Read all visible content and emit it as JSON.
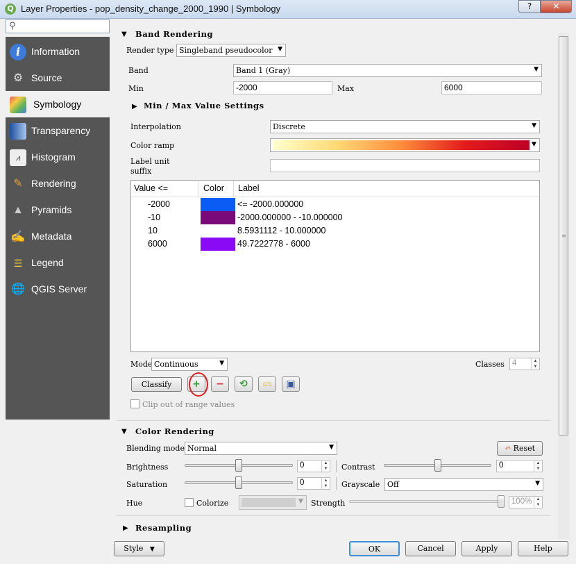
{
  "window": {
    "title": "Layer Properties - pop_density_change_2000_1990 | Symbology",
    "app_icon": "Q",
    "help_label": "?",
    "close_label": "✕"
  },
  "sidebar": {
    "search_placeholder": "",
    "items": [
      {
        "label": "Information",
        "icon": "info-icon"
      },
      {
        "label": "Source",
        "icon": "source-icon"
      },
      {
        "label": "Symbology",
        "icon": "symbology-icon"
      },
      {
        "label": "Transparency",
        "icon": "transparency-icon"
      },
      {
        "label": "Histogram",
        "icon": "histogram-icon"
      },
      {
        "label": "Rendering",
        "icon": "rendering-icon"
      },
      {
        "label": "Pyramids",
        "icon": "pyramids-icon"
      },
      {
        "label": "Metadata",
        "icon": "metadata-icon"
      },
      {
        "label": "Legend",
        "icon": "legend-icon"
      },
      {
        "label": "QGIS Server",
        "icon": "server-icon"
      }
    ],
    "active_index": 2
  },
  "band_rendering": {
    "title": "Band Rendering",
    "render_type_label": "Render type",
    "render_type_value": "Singleband pseudocolor",
    "band_label": "Band",
    "band_value": "Band 1 (Gray)",
    "min_label": "Min",
    "min_value": "-2000",
    "max_label": "Max",
    "max_value": "6000",
    "minmax_settings_label": "Min / Max Value Settings",
    "interpolation_label": "Interpolation",
    "interpolation_value": "Discrete",
    "color_ramp_label": "Color ramp",
    "color_ramp_colors": [
      "#ffffcc",
      "#fed976",
      "#fd8d3c",
      "#e31a1c",
      "#bd0026"
    ],
    "label_unit_label_1": "Label unit",
    "label_unit_label_2": "suffix",
    "label_unit_value": "",
    "table": {
      "headers": [
        "Value <=",
        "Color",
        "Label"
      ],
      "rows": [
        {
          "value": "-2000",
          "color": "#0a5cf5",
          "label": "<= -2000.000000"
        },
        {
          "value": "-10",
          "color": "#7a0a7a",
          "label": "-2000.000000 - -10.000000"
        },
        {
          "value": "10",
          "color": "#ffffff",
          "label": "8.5931112 - 10.000000"
        },
        {
          "value": "6000",
          "color": "#8a0af5",
          "label": "49.7222778 - 6000"
        }
      ]
    },
    "mode_label": "Mode",
    "mode_value": "Continuous",
    "classes_label": "Classes",
    "classes_value": "4",
    "classify_label": "Classify",
    "clip_label": "Clip out of range values"
  },
  "color_rendering": {
    "title": "Color Rendering",
    "blending_label": "Blending mode",
    "blending_value": "Normal",
    "reset_label": "Reset",
    "brightness_label": "Brightness",
    "brightness_value": "0",
    "contrast_label": "Contrast",
    "contrast_value": "0",
    "saturation_label": "Saturation",
    "saturation_value": "0",
    "grayscale_label": "Grayscale",
    "grayscale_value": "Off",
    "hue_label": "Hue",
    "colorize_label": "Colorize",
    "strength_label": "Strength",
    "strength_value": "100%"
  },
  "resampling": {
    "title": "Resampling"
  },
  "footer": {
    "style_label": "Style",
    "ok_label": "OK",
    "cancel_label": "Cancel",
    "apply_label": "Apply",
    "help_label": "Help"
  }
}
